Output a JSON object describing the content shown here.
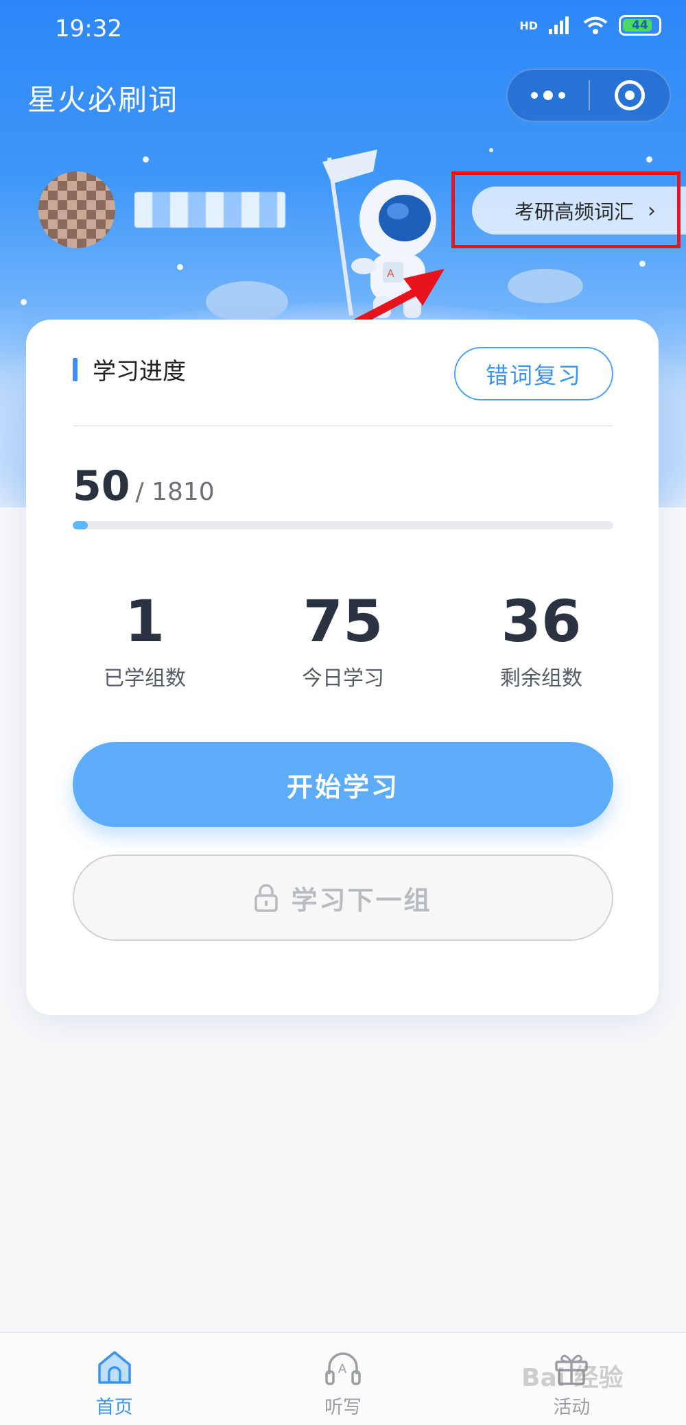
{
  "status_bar": {
    "time": "19:32",
    "network": "HD",
    "battery": "44"
  },
  "header": {
    "app_title": "星火必刷词"
  },
  "profile": {
    "vocab_button": "考研高频词汇"
  },
  "card": {
    "section_title": "学习进度",
    "review_button": "错词复习",
    "progress": {
      "learned": "50",
      "total": "/ 1810",
      "fraction": 0.0276
    },
    "stats": [
      {
        "value": "1",
        "label": "已学组数"
      },
      {
        "value": "75",
        "label": "今日学习"
      },
      {
        "value": "36",
        "label": "剩余组数"
      }
    ],
    "start_button": "开始学习",
    "next_button": "学习下一组"
  },
  "tabbar": {
    "items": [
      {
        "label": "首页",
        "icon": "home-icon",
        "active": true
      },
      {
        "label": "听写",
        "icon": "headphones-icon",
        "active": false
      },
      {
        "label": "活动",
        "icon": "gift-icon",
        "active": false
      }
    ]
  },
  "watermark": "Bai 经验",
  "colors": {
    "primary": "#3a92f3",
    "button": "#5cacf9",
    "highlight": "#e8131c"
  }
}
